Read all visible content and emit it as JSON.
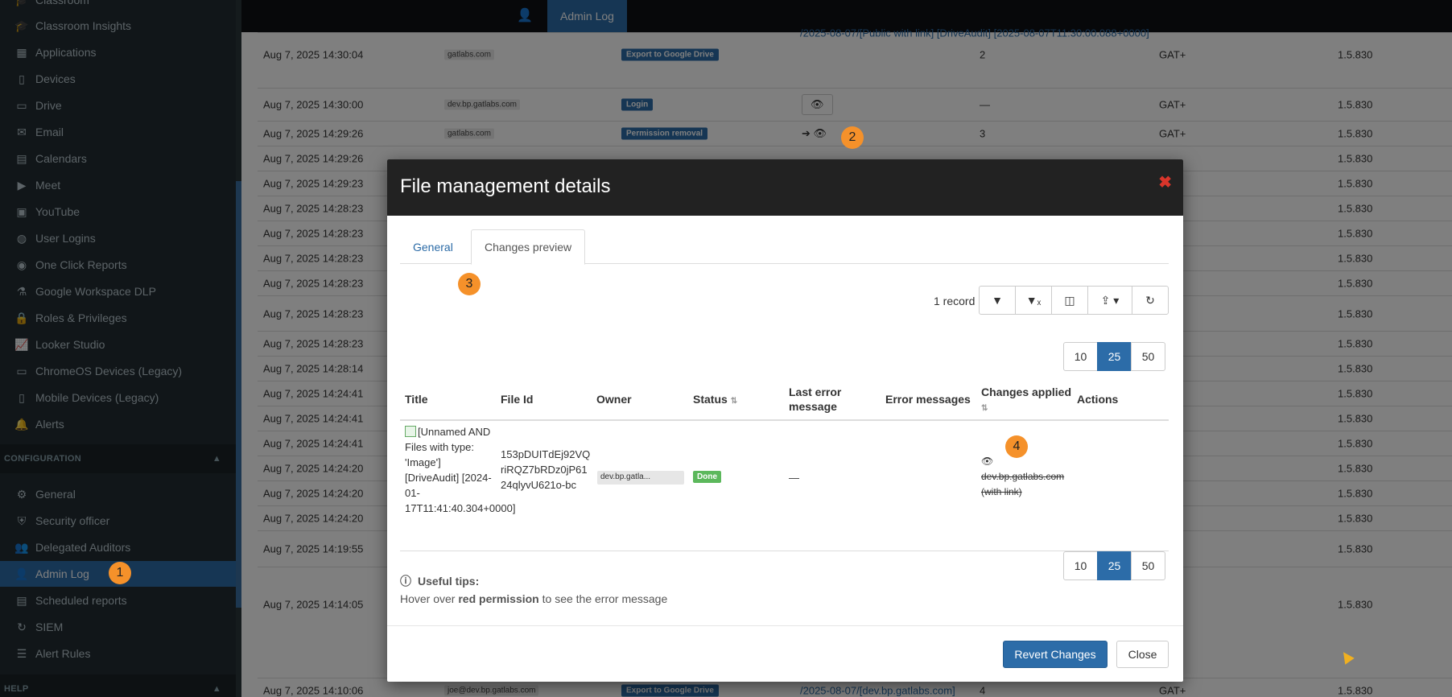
{
  "sidebar": {
    "items_top": [
      {
        "label": "Classroom",
        "icon": "graduation-cap-icon"
      },
      {
        "label": "Classroom Insights",
        "icon": "graduation-cap-icon"
      },
      {
        "label": "Applications",
        "icon": "grid-icon"
      },
      {
        "label": "Devices",
        "icon": "tablet-icon"
      },
      {
        "label": "Drive",
        "icon": "hdd-icon"
      },
      {
        "label": "Email",
        "icon": "envelope-icon"
      },
      {
        "label": "Calendars",
        "icon": "calendar-icon"
      },
      {
        "label": "Meet",
        "icon": "video-icon"
      },
      {
        "label": "YouTube",
        "icon": "film-icon"
      },
      {
        "label": "User Logins",
        "icon": "globe-icon"
      },
      {
        "label": "One Click Reports",
        "icon": "eye-icon"
      },
      {
        "label": "Google Workspace DLP",
        "icon": "flask-icon"
      },
      {
        "label": "Roles & Privileges",
        "icon": "lock-icon"
      },
      {
        "label": "Looker Studio",
        "icon": "line-chart-icon"
      },
      {
        "label": "ChromeOS Devices (Legacy)",
        "icon": "laptop-icon"
      },
      {
        "label": "Mobile Devices (Legacy)",
        "icon": "mobile-icon"
      },
      {
        "label": "Alerts",
        "icon": "bell-icon"
      }
    ],
    "config_section": "CONFIGURATION",
    "items_config": [
      {
        "label": "General",
        "icon": "gears-icon"
      },
      {
        "label": "Security officer",
        "icon": "shield-icon"
      },
      {
        "label": "Delegated Auditors",
        "icon": "users-icon"
      },
      {
        "label": "Admin Log",
        "icon": "user-star-icon"
      },
      {
        "label": "Scheduled reports",
        "icon": "calendar-icon"
      },
      {
        "label": "SIEM",
        "icon": "refresh-icon"
      },
      {
        "label": "Alert Rules",
        "icon": "list-icon"
      }
    ],
    "help_section": "HELP"
  },
  "topbar": {
    "tab_label": "Admin Log"
  },
  "background_rows": [
    {
      "date": "Aug 7, 2025 14:30:04",
      "user": "gatlabs.com",
      "action": "Export to Google Drive",
      "target": "/2025-08-07/[Public with link] [DriveAudit] [2025-08-07T11:30:00.088+0000]",
      "count": "2",
      "source": "GAT+",
      "version": "1.5.830"
    },
    {
      "date": "Aug 7, 2025 14:30:00",
      "user": "dev.bp.gatlabs.com",
      "action": "Login",
      "target": "",
      "count": "—",
      "source": "GAT+",
      "version": "1.5.830"
    },
    {
      "date": "Aug 7, 2025 14:29:26",
      "user": "gatlabs.com",
      "action": "Permission removal",
      "target": "",
      "count": "3",
      "source": "GAT+",
      "version": "1.5.830"
    },
    {
      "date": "Aug 7, 2025 14:29:26",
      "version": "1.5.830"
    },
    {
      "date": "Aug 7, 2025 14:29:23",
      "version": "1.5.830"
    },
    {
      "date": "Aug 7, 2025 14:28:23",
      "version": "1.5.830"
    },
    {
      "date": "Aug 7, 2025 14:28:23",
      "version": "1.5.830"
    },
    {
      "date": "Aug 7, 2025 14:28:23",
      "version": "1.5.830"
    },
    {
      "date": "Aug 7, 2025 14:28:23",
      "version": "1.5.830"
    },
    {
      "date": "Aug 7, 2025 14:28:23",
      "version": "1.5.830"
    },
    {
      "date": "Aug 7, 2025 14:28:23",
      "version": "1.5.830"
    },
    {
      "date": "Aug 7, 2025 14:28:14",
      "version": "1.5.830"
    },
    {
      "date": "Aug 7, 2025 14:24:41",
      "version": "1.5.830"
    },
    {
      "date": "Aug 7, 2025 14:24:41",
      "version": "1.5.830"
    },
    {
      "date": "Aug 7, 2025 14:24:41",
      "version": "1.5.830"
    },
    {
      "date": "Aug 7, 2025 14:24:20",
      "version": "1.5.830"
    },
    {
      "date": "Aug 7, 2025 14:24:20",
      "version": "1.5.830"
    },
    {
      "date": "Aug 7, 2025 14:24:20",
      "version": "1.5.830"
    },
    {
      "date": "Aug 7, 2025 14:19:55",
      "version": "1.5.830"
    },
    {
      "date": "Aug 7, 2025 14:14:05",
      "version": "1.5.830"
    },
    {
      "date": "Aug 7, 2025 14:10:06",
      "user": "joe@dev.bp.gatlabs.com",
      "action": "Export to Google Drive",
      "target": "/2025-08-07/[dev.bp.gatlabs.com]",
      "count": "4",
      "source": "GAT+",
      "version": "1.5.830"
    }
  ],
  "modal": {
    "title": "File management details",
    "tabs": [
      "General",
      "Changes preview"
    ],
    "record_count": "1 record",
    "page_sizes": [
      "10",
      "25",
      "50"
    ],
    "selected_page_size": "25",
    "columns": [
      "Title",
      "File Id",
      "Owner",
      "Status",
      "Last error message",
      "Error messages",
      "Changes applied",
      "Actions"
    ],
    "row": {
      "title": "[Unnamed AND Files with type: 'Image'] [DriveAudit] [2024-01-17T11:41:40.304+0000]",
      "file_id": "153pDUITdEj92VQriRQZ7bRDz0jP6124qlyvU621o-bc",
      "owner": "dev.bp.gatla...",
      "status": "Done",
      "last_error": "—",
      "error_messages": "",
      "changes_applied": "dev.bp.gatlabs.com (with link)"
    },
    "tips_heading": "Useful tips:",
    "tips_prefix": "Hover over ",
    "tips_bold": "red permission",
    "tips_suffix": " to see the error message",
    "revert_label": "Revert Changes",
    "close_label": "Close"
  },
  "markers": [
    "1",
    "2",
    "3",
    "4"
  ],
  "colors": {
    "sidebar_bg": "#222d32",
    "accent": "#2c6ca8",
    "marker": "#f5912a",
    "done": "#5cb85c",
    "close_x": "#d9352b"
  }
}
